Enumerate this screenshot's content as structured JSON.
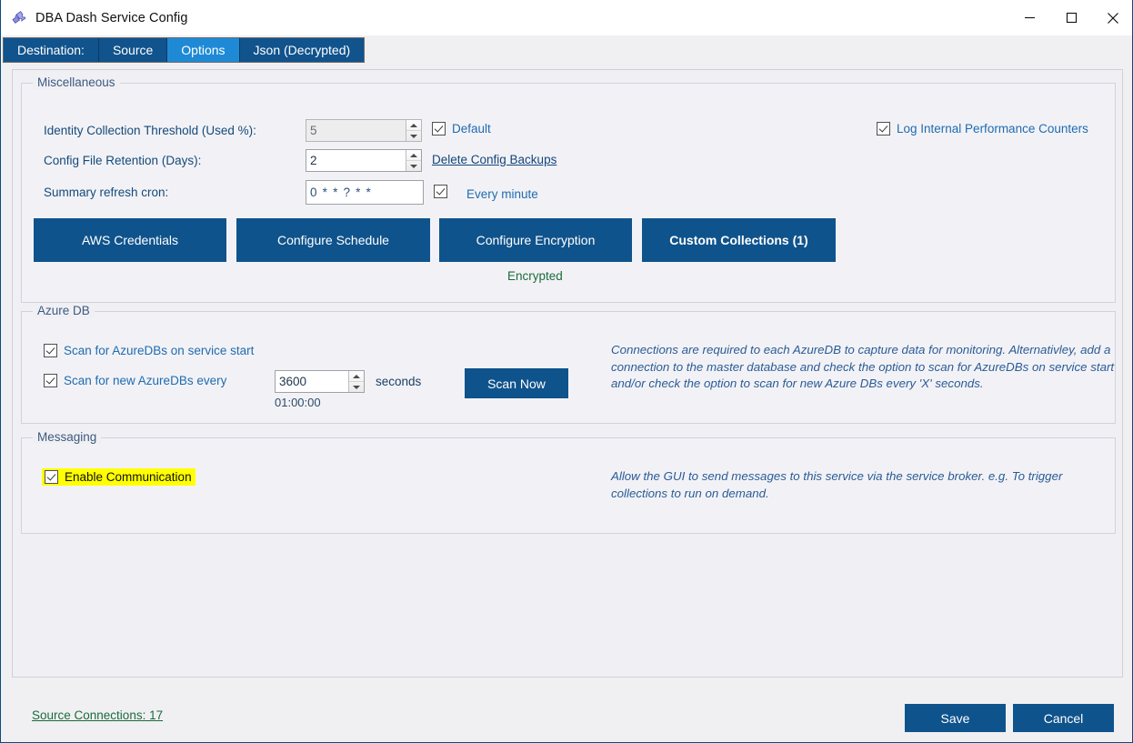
{
  "window": {
    "title": "DBA Dash Service Config",
    "icon": "puzzle-piece-icon",
    "minimize": "—",
    "maximize": "□",
    "close": "✕",
    "accent_color": "#0f538c",
    "tab_active_color": "#1e8ad6",
    "highlight_color": "#ffff00",
    "link_green": "#1b6b3a"
  },
  "tabs": [
    {
      "label": "Destination:",
      "active": false
    },
    {
      "label": "Source",
      "active": false
    },
    {
      "label": "Options",
      "active": true
    },
    {
      "label": "Json (Decrypted)",
      "active": false
    }
  ],
  "miscellaneous": {
    "title": "Miscellaneous",
    "identity_threshold": {
      "label": "Identity Collection Threshold (Used %):",
      "value": "5",
      "disabled": true,
      "default_checkbox": {
        "label": "Default",
        "checked": true
      }
    },
    "config_retention": {
      "label": "Config File Retention (Days):",
      "value": "2",
      "link": "Delete Config Backups"
    },
    "summary_cron": {
      "label": "Summary refresh cron:",
      "value": "0 * * ? * *",
      "checkbox_checked": true,
      "description": "Every minute"
    },
    "log_counters": {
      "label": "Log Internal Performance Counters",
      "checked": true
    },
    "buttons": [
      {
        "label": "AWS Credentials",
        "bold": false
      },
      {
        "label": "Configure Schedule",
        "bold": false
      },
      {
        "label": "Configure Encryption",
        "bold": false
      },
      {
        "label": "Custom Collections (1)",
        "bold": true
      }
    ],
    "encrypted_status": "Encrypted"
  },
  "azure_db": {
    "title": "Azure DB",
    "scan_on_start": {
      "label": "Scan for AzureDBs on service start",
      "checked": true
    },
    "scan_every": {
      "label": "Scan for new AzureDBs every",
      "checked": true
    },
    "interval_value": "3600",
    "interval_units": "seconds",
    "interval_readable": "01:00:00",
    "scan_now_button": "Scan Now",
    "note": "Connections are required to each AzureDB to capture data for monitoring. Alternativley, add a connection to the master database and check the option to scan for AzureDBs on service start and/or check the option to scan for new Azure DBs every 'X' seconds."
  },
  "messaging": {
    "title": "Messaging",
    "enable_communication": {
      "label": "Enable Communication",
      "checked": true,
      "highlighted": true
    },
    "note": "Allow the GUI to send messages to this service via the service broker.  e.g. To trigger collections to run on demand."
  },
  "footer": {
    "source_connections_link": "Source Connections: 17",
    "save_label": "Save",
    "cancel_label": "Cancel"
  }
}
